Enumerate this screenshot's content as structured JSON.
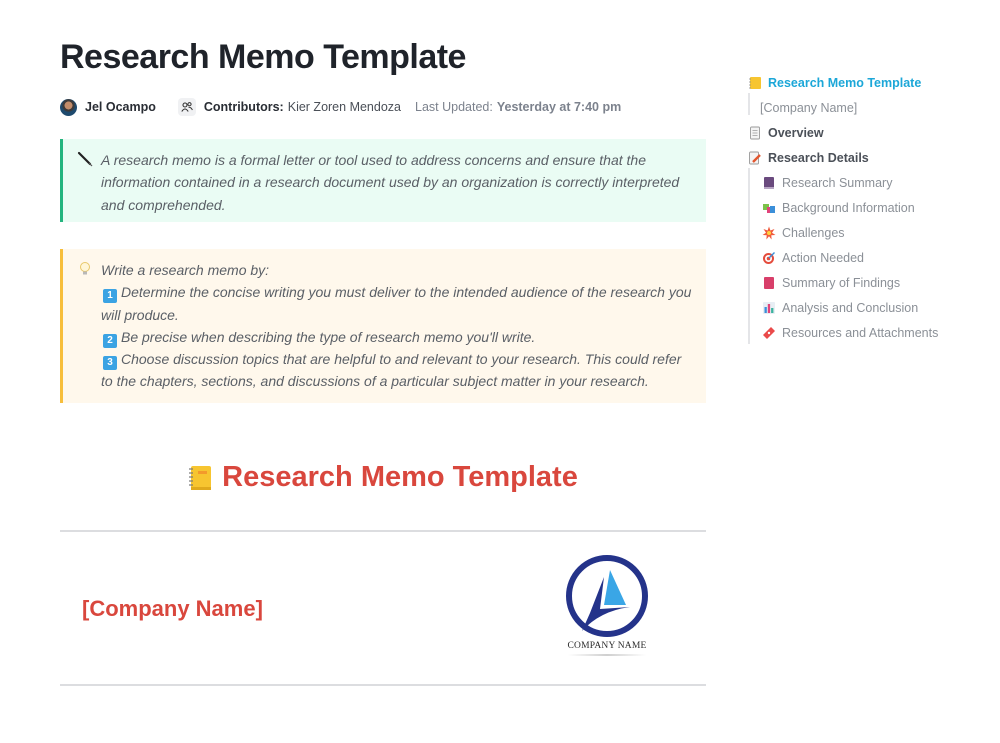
{
  "page": {
    "title": "Research Memo Template",
    "author": "Jel Ocampo",
    "contributors_label": "Contributors:",
    "contributors": "Kier Zoren Mendoza",
    "last_updated_label": "Last Updated:",
    "last_updated_value": "Yesterday at 7:40 pm"
  },
  "callouts": {
    "definition": {
      "icon": "feather-pen-icon",
      "text": "A research memo is a formal letter or tool used to address concerns and ensure that the information contained in a research document used by an organization is correctly interpreted and comprehended."
    },
    "instructions": {
      "icon": "light-bulb-icon",
      "intro": "Write a research memo by:",
      "steps": [
        {
          "badge": "1",
          "text": "Determine the concise writing you must deliver to the intended audience of the research you will produce."
        },
        {
          "badge": "2",
          "text": "Be precise when describing the type of research memo you'll write."
        },
        {
          "badge": "3",
          "text": "Choose discussion topics that are helpful to and relevant to your research. This could refer to the chapters, sections, and discussions of a particular subject matter in your research."
        }
      ]
    }
  },
  "body": {
    "heading": "Research Memo Template",
    "heading_icon": "notebook-icon",
    "company_placeholder": "[Company Name]",
    "logo_text": "COMPANY NAME"
  },
  "toc": {
    "items": [
      {
        "label": "Research Memo Template",
        "icon": "notebook-icon",
        "level": "active"
      },
      {
        "label": "[Company Name]",
        "icon": "",
        "level": "sub1"
      },
      {
        "label": "Overview",
        "icon": "page-icon",
        "level": "h2"
      },
      {
        "label": "Research Details",
        "icon": "memo-pencil-icon",
        "level": "h2"
      },
      {
        "label": "Research Summary",
        "icon": "book-icon",
        "level": "sub2"
      },
      {
        "label": "Background Information",
        "icon": "books-icon",
        "level": "sub2"
      },
      {
        "label": "Challenges",
        "icon": "collision-icon",
        "level": "sub2"
      },
      {
        "label": "Action Needed",
        "icon": "target-icon",
        "level": "sub2"
      },
      {
        "label": "Summary of Findings",
        "icon": "red-book-icon",
        "level": "sub2"
      },
      {
        "label": "Analysis and Conclusion",
        "icon": "bar-chart-icon",
        "level": "sub2"
      },
      {
        "label": "Resources and Attachments",
        "icon": "ticket-icon",
        "level": "sub2"
      }
    ]
  },
  "colors": {
    "accent_red": "#d9473d",
    "toc_active": "#1ca7d8",
    "callout_green_border": "#24b47e",
    "callout_yellow_border": "#f7be3b"
  }
}
